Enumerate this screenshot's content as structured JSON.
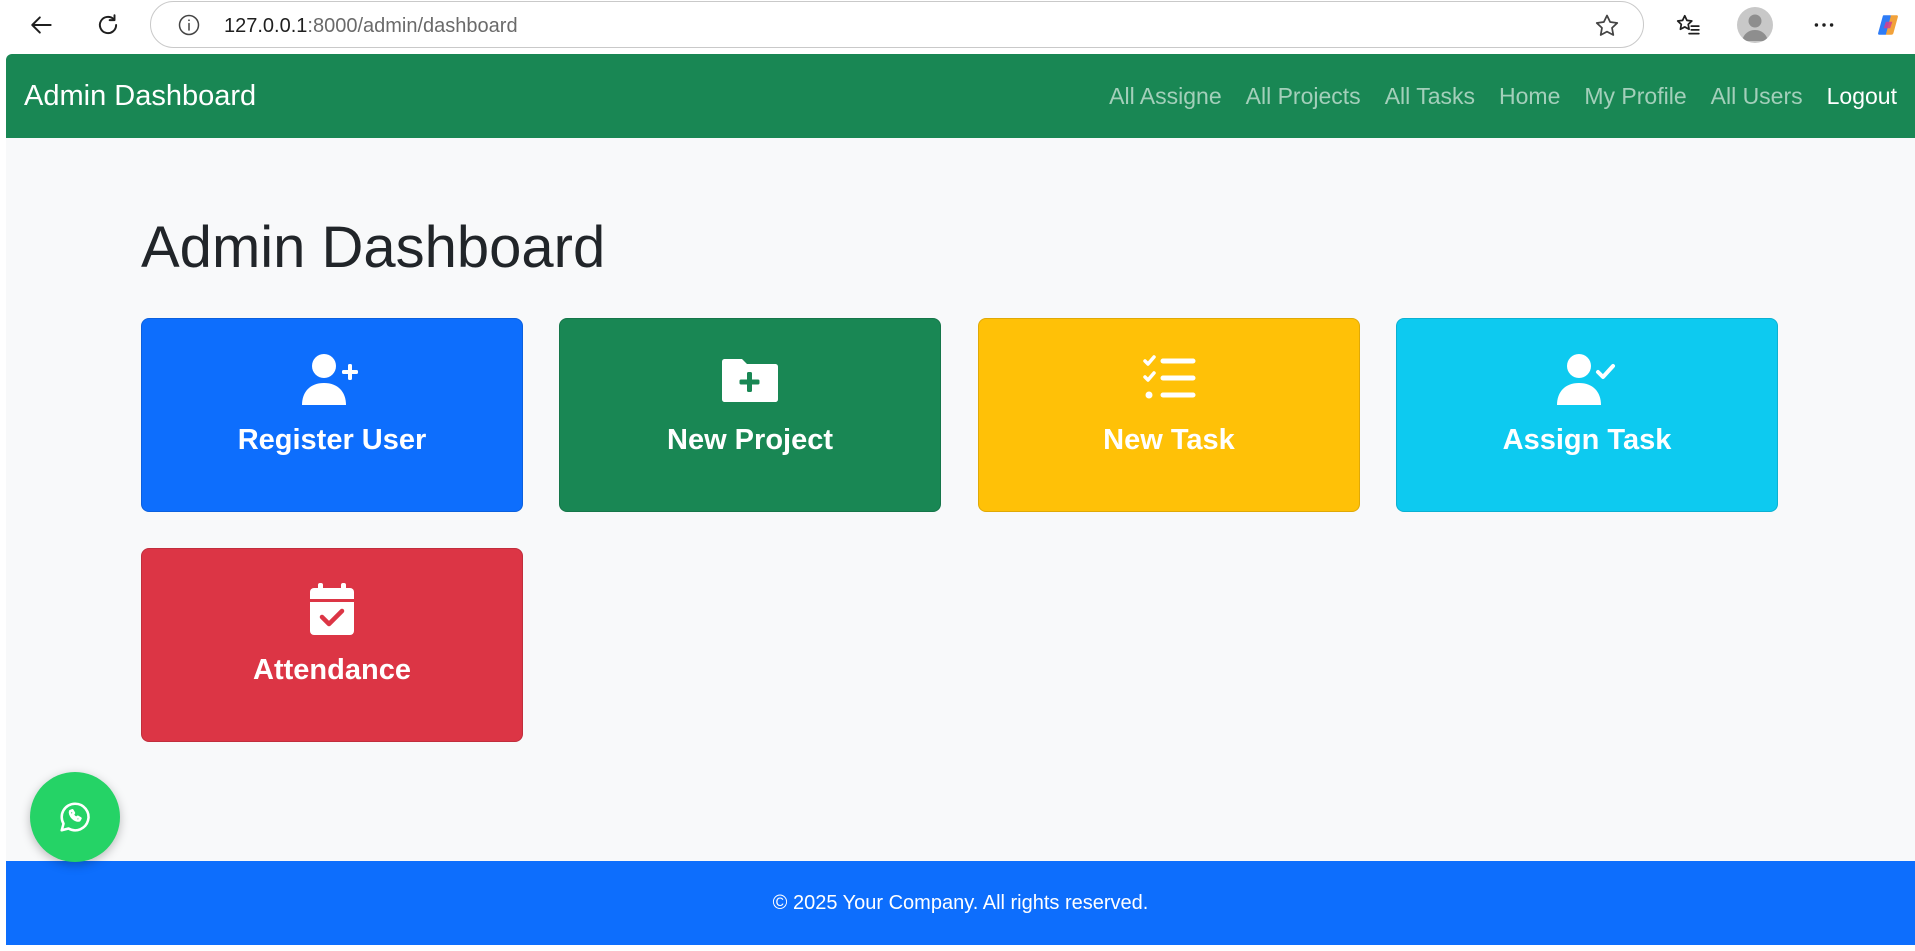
{
  "browser": {
    "url_host": "127.0.0.1",
    "url_path": ":8000/admin/dashboard"
  },
  "navbar": {
    "brand": "Admin Dashboard",
    "links": [
      {
        "label": "All Assigne",
        "active": false
      },
      {
        "label": "All Projects",
        "active": false
      },
      {
        "label": "All Tasks",
        "active": false
      },
      {
        "label": "Home",
        "active": false
      },
      {
        "label": "My Profile",
        "active": false
      },
      {
        "label": "All Users",
        "active": false
      },
      {
        "label": "Logout",
        "active": true
      }
    ],
    "color": "#198754"
  },
  "main": {
    "title": "Admin Dashboard",
    "cards": [
      {
        "label": "Register User",
        "icon": "user-plus-icon",
        "color": "#0d6efd"
      },
      {
        "label": "New Project",
        "icon": "folder-plus-icon",
        "color": "#198754"
      },
      {
        "label": "New Task",
        "icon": "list-check-icon",
        "color": "#ffc107"
      },
      {
        "label": "Assign Task",
        "icon": "user-check-icon",
        "color": "#0dcaf0"
      },
      {
        "label": "Attendance",
        "icon": "calendar-check-icon",
        "color": "#dc3545"
      }
    ]
  },
  "footer": {
    "text": "© 2025 Your Company. All rights reserved.",
    "color": "#0d6efd"
  },
  "floating_button": {
    "icon": "whatsapp-icon",
    "color": "#25d366"
  }
}
